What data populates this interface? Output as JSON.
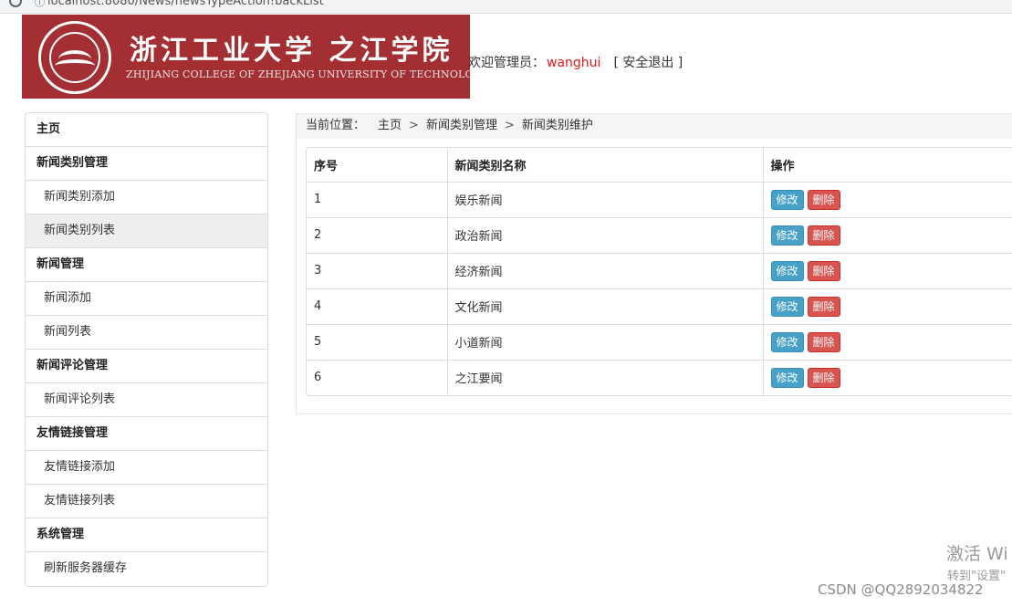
{
  "browser": {
    "url": "localhost:8080/News/newsTypeAction!backList"
  },
  "header": {
    "school_cn": "浙江工业大学 之江学院",
    "school_en": "ZHIJIANG COLLEGE OF ZHEJIANG UNIVERSITY OF TECHNOLOGY",
    "welcome_label": "欢迎管理员：",
    "username": "wanghui",
    "logout_label": "[ 安全退出 ]",
    "brand_color": "#a32f33"
  },
  "sidebar": {
    "items": [
      {
        "label": "主页",
        "type": "group"
      },
      {
        "label": "新闻类别管理",
        "type": "group"
      },
      {
        "label": "新闻类别添加",
        "type": "link"
      },
      {
        "label": "新闻类别列表",
        "type": "link",
        "active": true
      },
      {
        "label": "新闻管理",
        "type": "group"
      },
      {
        "label": "新闻添加",
        "type": "link"
      },
      {
        "label": "新闻列表",
        "type": "link"
      },
      {
        "label": "新闻评论管理",
        "type": "group"
      },
      {
        "label": "新闻评论列表",
        "type": "link"
      },
      {
        "label": "友情链接管理",
        "type": "group"
      },
      {
        "label": "友情链接添加",
        "type": "link"
      },
      {
        "label": "友情链接列表",
        "type": "link"
      },
      {
        "label": "系统管理",
        "type": "group"
      },
      {
        "label": "刷新服务器缓存",
        "type": "link"
      }
    ]
  },
  "breadcrumb": {
    "lead": "当前位置：",
    "items": [
      "主页",
      "新闻类别管理",
      "新闻类别维护"
    ],
    "separator": ">"
  },
  "table": {
    "headers": [
      "序号",
      "新闻类别名称",
      "操作"
    ],
    "edit_label": "修改",
    "delete_label": "删除",
    "rows": [
      {
        "id": "1",
        "name": "娱乐新闻"
      },
      {
        "id": "2",
        "name": "政治新闻"
      },
      {
        "id": "3",
        "name": "经济新闻"
      },
      {
        "id": "4",
        "name": "文化新闻"
      },
      {
        "id": "5",
        "name": "小道新闻"
      },
      {
        "id": "6",
        "name": "之江要闻"
      }
    ]
  },
  "watermarks": {
    "activate": "激活 Wi",
    "activate_sub": "转到\"设置\"",
    "csdn": "CSDN @QQ2892034822"
  }
}
